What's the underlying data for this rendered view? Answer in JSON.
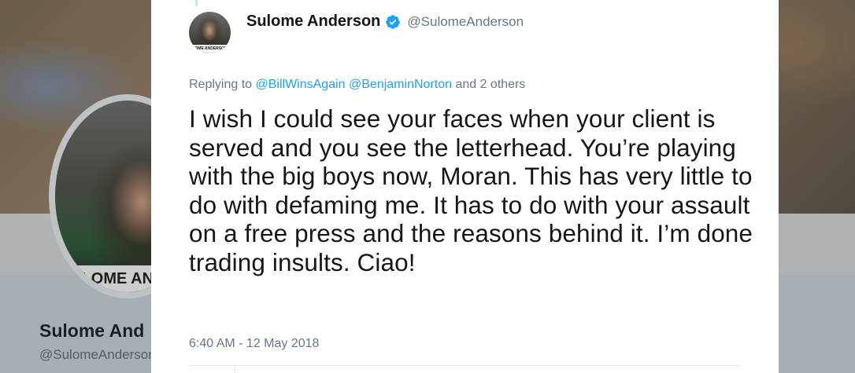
{
  "background_profile": {
    "avatar_strip_text": "’LOME ANDE",
    "name": "Sulome And",
    "handle": "@SulomeAndersor"
  },
  "tweet": {
    "author": {
      "display_name": "Sulome Anderson",
      "handle": "@SulomeAnderson",
      "verified": true,
      "avatar_strip_text": "LOME ANDERSON"
    },
    "replying": {
      "prefix": "Replying to",
      "mentions": [
        "@BillWinsAgain",
        "@BenjaminNorton"
      ],
      "suffix": "and 2 others"
    },
    "text": "I wish I could see your faces when your client is served and you see the letterhead. You’re playing with the big boys now, Moran. This has very little to do with defaming me. It has to do with your assault on a free press and the reasons behind it. I’m done trading insults. Ciao!",
    "timestamp": "6:40 AM - 12 May 2018"
  },
  "colors": {
    "link": "#1da1f2",
    "text": "#14171a",
    "muted": "#657786",
    "verified_badge": "#1da1f2"
  },
  "icons": {
    "verified": "verified-badge-icon"
  }
}
